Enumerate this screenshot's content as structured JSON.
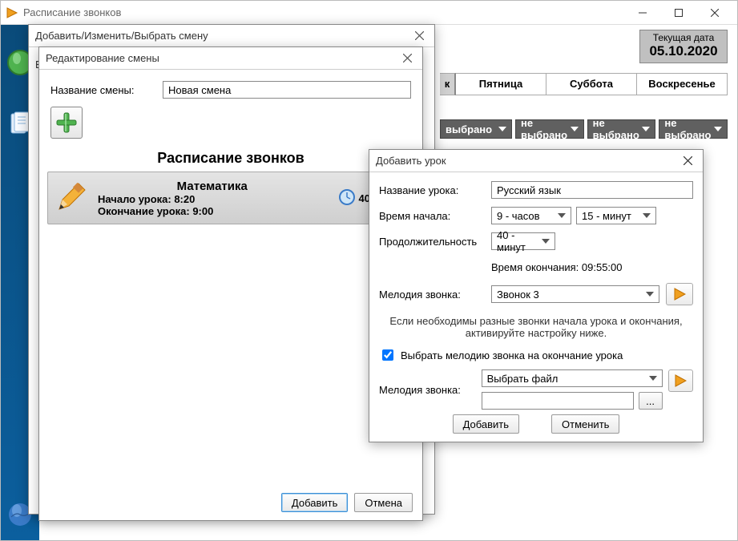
{
  "app": {
    "title": "Расписание звонков"
  },
  "bg": {
    "date_label": "Текущая дата",
    "date_value": "05.10.2020",
    "day_k": "к",
    "days": [
      "Пятница",
      "Суббота",
      "Воскресенье"
    ],
    "sel_text": "не выбрано",
    "sel_partial": "выбрано"
  },
  "dlg_shift_select": {
    "title": "Добавить/Изменить/Выбрать смену",
    "v_letter": "В"
  },
  "dlg_edit_shift": {
    "title": "Редактирование смены",
    "name_label": "Название смены:",
    "name_value": "Новая смена",
    "schedule_header": "Расписание звонков",
    "add_button": "Добавить",
    "cancel_button": "Отмена",
    "lesson": {
      "subject": "Математика",
      "start_label": "Начало урока: 8:20",
      "end_label": "Окончание урока: 9:00",
      "duration": "40"
    }
  },
  "dlg_add_lesson": {
    "title": "Добавить урок",
    "name_label": "Название урока:",
    "name_value": "Русский язык",
    "start_label": "Время начала:",
    "hours_value": "9 - часов",
    "minutes_value": "15 - минут",
    "duration_label": "Продолжительность",
    "duration_value": "40 - минут",
    "end_time_label": "Время окончания: 09:55:00",
    "melody_label": "Мелодия звонка:",
    "melody_value": "Звонок 3",
    "note_line1": "Если необходимы разные звонки начала урока и окончания,",
    "note_line2": "активируйте настройку ниже.",
    "checkbox_label": "Выбрать мелодию звонка на окончание урока",
    "melody2_label": "Мелодия звонка:",
    "melody2_value": "Выбрать файл",
    "browse_label": "...",
    "add_button": "Добавить",
    "cancel_button": "Отменить"
  }
}
